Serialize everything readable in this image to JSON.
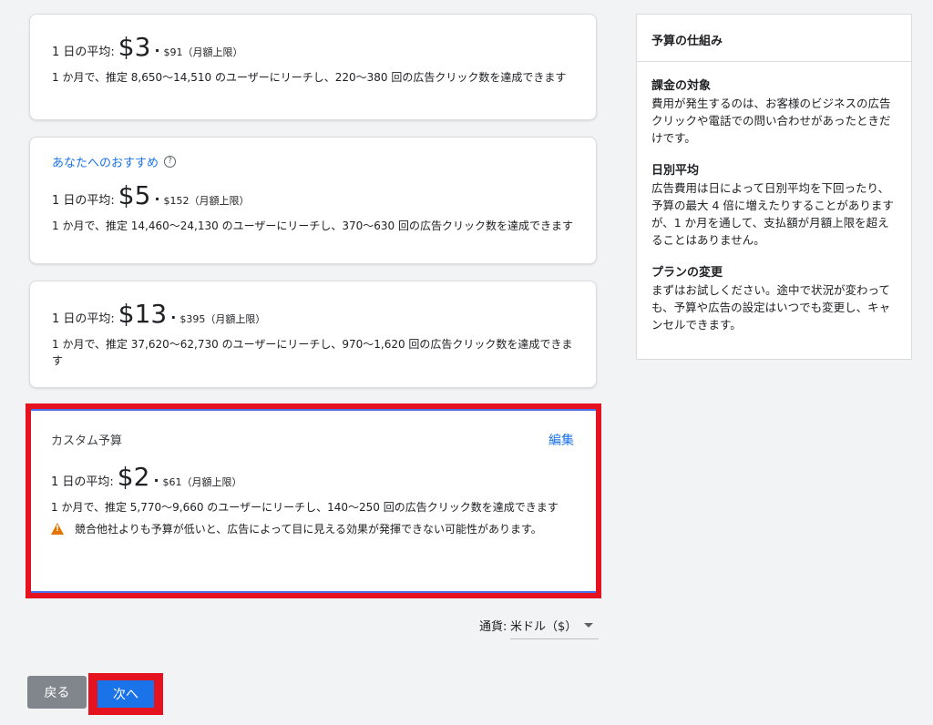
{
  "plans": [
    {
      "avg_label": "1 日の平均:",
      "price": "$3",
      "monthly": "$91（月額上限）",
      "description": "1 か月で、推定 8,650〜14,510 のユーザーにリーチし、220〜380 回の広告クリック数を達成できます"
    },
    {
      "recommend_label": "あなたへのおすすめ",
      "avg_label": "1 日の平均:",
      "price": "$5",
      "monthly": "$152（月額上限）",
      "description": "1 か月で、推定 14,460〜24,130 のユーザーにリーチし、370〜630 回の広告クリック数を達成できます"
    },
    {
      "avg_label": "1 日の平均:",
      "price": "$13",
      "monthly": "$395（月額上限）",
      "description": "1 か月で、推定 37,620〜62,730 のユーザーにリーチし、970〜1,620 回の広告クリック数を達成できます"
    }
  ],
  "custom": {
    "title": "カスタム予算",
    "edit_label": "編集",
    "avg_label": "1 日の平均:",
    "price": "$2",
    "monthly": "$61（月額上限）",
    "description": "1 か月で、推定 5,770〜9,660 のユーザーにリーチし、140〜250 回の広告クリック数を達成できます",
    "warning": "競合他社よりも予算が低いと、広告によって目に見える効果が発揮できない可能性があります。"
  },
  "currency": {
    "label": "通貨:",
    "value": "米ドル（$）"
  },
  "buttons": {
    "back": "戻る",
    "next": "次へ"
  },
  "side_panel": {
    "title": "予算の仕組み",
    "sections": [
      {
        "heading": "課金の対象",
        "body": "費用が発生するのは、お客様のビジネスの広告クリックや電話での問い合わせがあったときだけです。"
      },
      {
        "heading": "日別平均",
        "body": "広告費用は日によって日別平均を下回ったり、予算の最大 4 倍に増えたりすることがありますが、1 か月を通して、支払額が月額上限を超えることはありません。"
      },
      {
        "heading": "プランの変更",
        "body": "まずはお試しください。途中で状況が変わっても、予算や広告の設定はいつでも変更し、キャンセルできます。"
      }
    ]
  },
  "colors": {
    "accent": "#1a73e8",
    "highlight": "#e5131f",
    "warning": "#e37400"
  }
}
